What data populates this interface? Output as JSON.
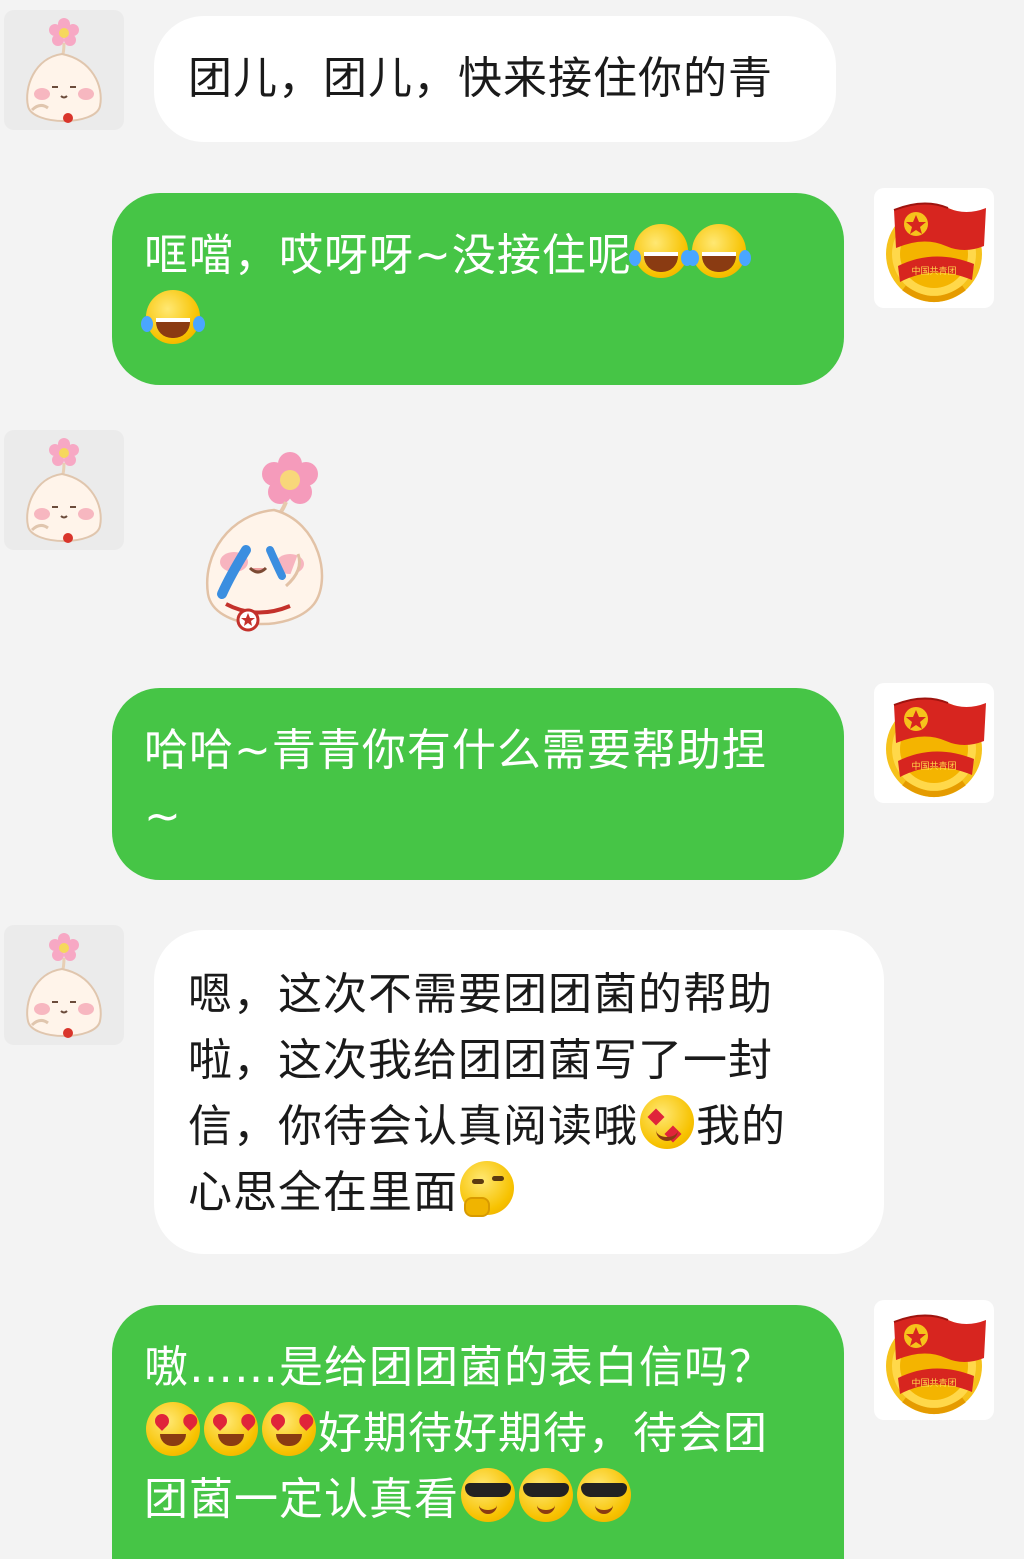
{
  "colors": {
    "background": "#f3f3f3",
    "incoming_bubble": "#ffffff",
    "outgoing_bubble": "#46c546",
    "outgoing_text": "#ffffff",
    "incoming_text": "#1a1a1a"
  },
  "avatars": {
    "incoming": "qingqing-dumpling-avatar",
    "outgoing": "youth-league-emblem-avatar"
  },
  "messages": [
    {
      "side": "incoming",
      "lines": [
        "团儿，团儿，快来接住你的青"
      ]
    },
    {
      "side": "outgoing",
      "lines": [
        "哐噹，哎呀呀~没接住呢"
      ],
      "emojis": [
        "face-with-tears-of-joy",
        "face-with-tears-of-joy",
        "face-with-tears-of-joy"
      ]
    },
    {
      "side": "incoming",
      "sticker": "crying-dumpling-sticker"
    },
    {
      "side": "outgoing",
      "lines": [
        "哈哈~青青你有什么需要帮助捏",
        "~"
      ]
    },
    {
      "side": "incoming",
      "lines": [
        "嗯，这次不需要团团菌的帮助",
        "啦，这次我给团团菌写了一封",
        "信，你待会认真阅读哦",
        "我的",
        "心思全在里面"
      ],
      "emojis": [
        "star-struck-face",
        "thinking-face"
      ]
    },
    {
      "side": "outgoing",
      "lines": [
        "嗷……是给团团菌的表白信吗？",
        "好期待好期待，待会团",
        "团菌一定认真看"
      ],
      "emojis": [
        "heart-eyes-face",
        "heart-eyes-face",
        "heart-eyes-face",
        "sunglasses-face",
        "sunglasses-face",
        "sunglasses-face"
      ]
    }
  ]
}
